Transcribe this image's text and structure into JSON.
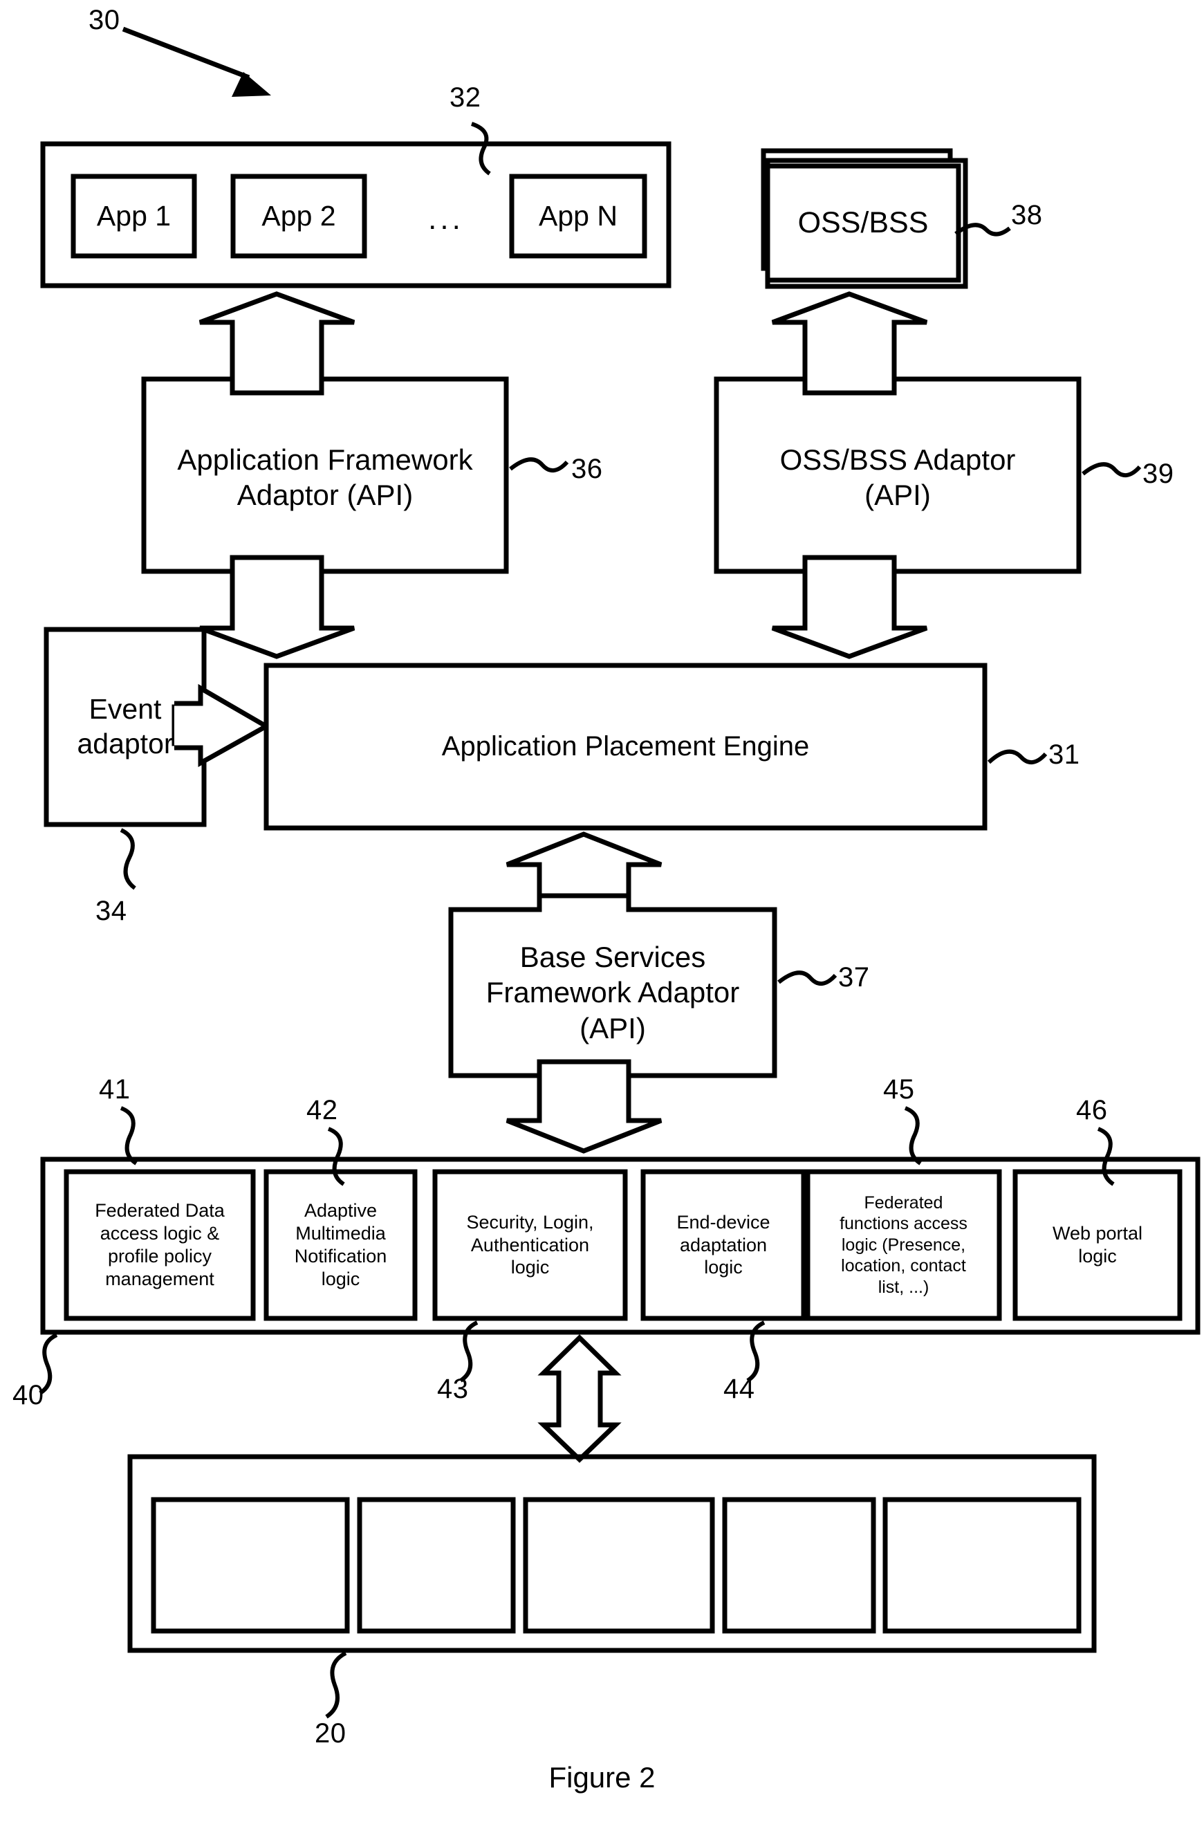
{
  "figure": {
    "caption": "Figure 2",
    "overall_ref": "30"
  },
  "application_layer": {
    "ref": "32",
    "apps": [
      {
        "label": "App 1"
      },
      {
        "label": "App 2"
      },
      {
        "label": "App N"
      }
    ],
    "ellipsis": "..."
  },
  "oss_bss": {
    "label": "OSS/BSS",
    "ref": "38"
  },
  "adaptors": {
    "application_framework": {
      "line1": "Application Framework",
      "line2": "Adaptor (API)",
      "ref": "36"
    },
    "oss_bss_adaptor": {
      "line1": "OSS/BSS Adaptor",
      "line2": "(API)",
      "ref": "39"
    },
    "base_services": {
      "line1": "Base Services",
      "line2": "Framework Adaptor",
      "line3": "(API)",
      "ref": "37"
    }
  },
  "engine": {
    "label": "Application Placement Engine",
    "ref": "31"
  },
  "event_adaptor": {
    "line1": "Event",
    "line2": "adaptor",
    "ref": "34"
  },
  "service_layer": {
    "ref": "40",
    "boxes": [
      {
        "label": "Federated Data\naccess logic &\nprofile policy\nmanagement",
        "ref": "41"
      },
      {
        "label": "Adaptive\nMultimedia\nNotification\nlogic",
        "ref": "42"
      },
      {
        "label": "Security, Login,\nAuthentication\nlogic",
        "ref": "43"
      },
      {
        "label": "End-device\nadaptation\nlogic",
        "ref": "44"
      },
      {
        "label": "Federated\nfunctions access\nlogic (Presence,\nlocation, contact\nlist, ...)",
        "ref": "45"
      },
      {
        "label": "Web portal\nlogic",
        "ref": "46"
      }
    ]
  },
  "network_layer": {
    "ref": "20",
    "boxes": [
      {
        "label": ""
      },
      {
        "label": ""
      },
      {
        "label": ""
      },
      {
        "label": ""
      },
      {
        "label": ""
      }
    ]
  }
}
